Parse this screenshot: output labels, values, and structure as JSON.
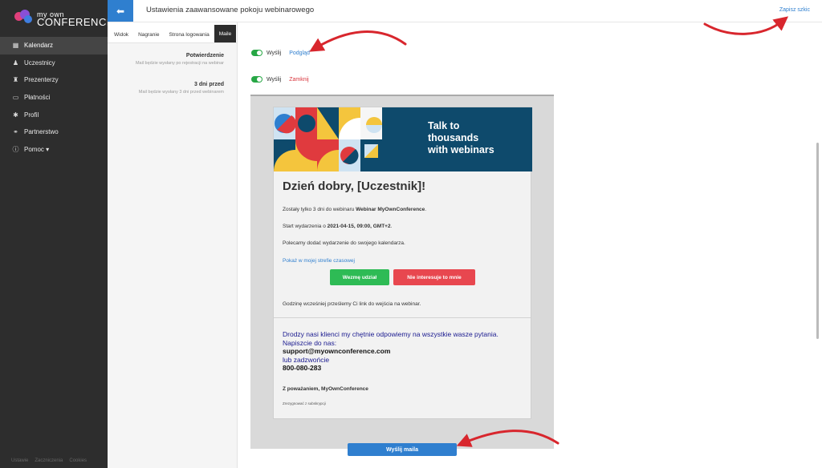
{
  "brand": {
    "logo_small": "my own",
    "logo_big": "CONFERENCE",
    "colors": {
      "accent": "#2f7fcf",
      "sidebar": "#2d2d2d",
      "success": "#2ebb55",
      "danger": "#e8474f",
      "banner": "#0e4a6c"
    }
  },
  "sidebar": {
    "items": [
      {
        "label": "Kalendarz",
        "icon": "calendar-icon",
        "glyph": "▦"
      },
      {
        "label": "Uczestnicy",
        "icon": "users-icon",
        "glyph": "♟"
      },
      {
        "label": "Prezenterzy",
        "icon": "presenter-icon",
        "glyph": "♜"
      },
      {
        "label": "Płatności",
        "icon": "wallet-icon",
        "glyph": "▭"
      },
      {
        "label": "Profil",
        "icon": "gear-icon",
        "glyph": "✱"
      },
      {
        "label": "Partnerstwo",
        "icon": "handshake-icon",
        "glyph": "⚭"
      },
      {
        "label": "Pomoc ▾",
        "icon": "info-icon",
        "glyph": "ⓘ"
      }
    ],
    "footer": [
      "Ustawie",
      "Zaczniczenia",
      "Cookies"
    ]
  },
  "header": {
    "back_icon": "arrow-left-icon",
    "back_glyph": "⬅",
    "title": "Ustawienia zaawansowane pokoju webinarowego",
    "save_draft": "Zapisz szkic"
  },
  "tabs": [
    {
      "label": "Widok"
    },
    {
      "label": "Nagranie"
    },
    {
      "label": "Strona logowania"
    },
    {
      "label": "Maile"
    }
  ],
  "mails": [
    {
      "title": "Potwierdzenie",
      "desc": "Mail będzie wysłany po rejestracji na webinar",
      "toggle_label": "Wyślij",
      "action": "Podgląd"
    },
    {
      "title": "3 dni przed",
      "desc": "Mail będzie wysłany 3 dni przed webinarem",
      "toggle_label": "Wyślij",
      "action": "Zamknij"
    }
  ],
  "email": {
    "banner_line1": "Talk to",
    "banner_line2": "thousands",
    "banner_line3": "with webinars",
    "greeting": "Dzień dobry, [Uczestnik]!",
    "p1_text": "Zostały tylko 3 dni do webinaru ",
    "p1_bold": "Webinar MyOwnConference",
    "p1_end": ".",
    "p2_text": "Start wydarzenia o ",
    "p2_bold": "2021-04-15, 09:00, GMT+2",
    "p2_end": ".",
    "p3": "Polecamy dodać wydarzenie do swojego kalendarza.",
    "timezone_link": "Pokaż w mojej strefie czasowej",
    "btn_accept": "Wezmę udział",
    "btn_decline": "Nie interesuje to mnie",
    "p4": "Godzinę wcześniej prześlemy Ci link do wejścia na webinar.",
    "contact_line1": "Drodzy nasi klienci my chętnie odpowiemy na wszystkie wasze pytania.",
    "contact_line2": "Napiszcie do nas:",
    "contact_email": "support@myownconference.com",
    "contact_line3": "lub zadzwońcie",
    "contact_phone": "800-080-283",
    "regards": "Z poważaniem, MyOwnConference",
    "unsubscribe": "Zrezygnować z subskrypcji"
  },
  "send_button": "Wyślij maila"
}
